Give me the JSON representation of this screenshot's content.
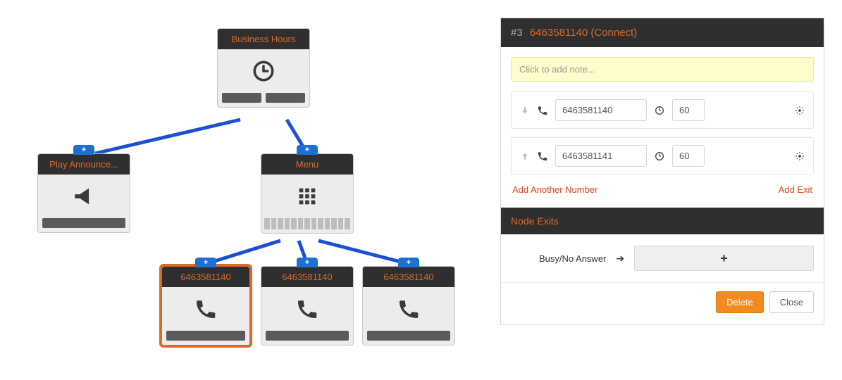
{
  "nodes": {
    "bh": {
      "title": "Business Hours"
    },
    "ann": {
      "title": "Play Announce..."
    },
    "menu": {
      "title": "Menu"
    },
    "c1": {
      "title": "6463581140"
    },
    "c2": {
      "title": "6463581140"
    },
    "c3": {
      "title": "6463581140"
    }
  },
  "panel": {
    "index": "#3",
    "title": "6463581140 (Connect)",
    "note_placeholder": "Click to add note...",
    "rows": [
      {
        "phone": "6463581140",
        "duration": "60"
      },
      {
        "phone": "6463581141",
        "duration": "60"
      }
    ],
    "add_number": "Add Another Number",
    "add_exit": "Add Exit",
    "exits_head": "Node Exits",
    "exit_label": "Busy/No Answer",
    "delete": "Delete",
    "close": "Close"
  }
}
